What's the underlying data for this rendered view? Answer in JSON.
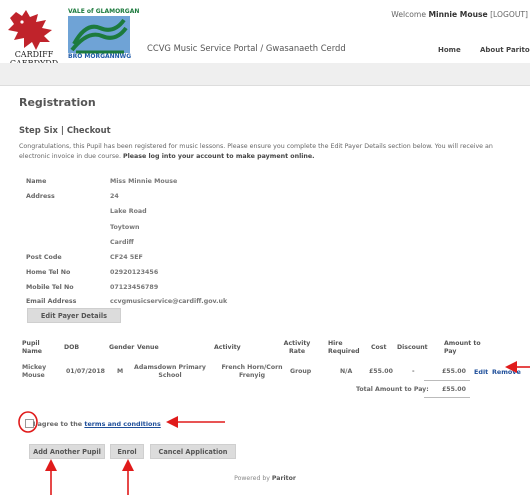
{
  "header": {
    "cardiff_logo_line1": "CARDIFF",
    "cardiff_logo_line2": "CAERDYDD",
    "vog_logo_top": "VALE of GLAMORGAN",
    "vog_logo_bottom": "BRO MORGANNWG",
    "portal_title": "CCVG Music Service Portal / Gwasanaeth Cerdd",
    "welcome_prefix": "Welcome",
    "user_name": "Minnie Mouse",
    "logout_label": "[LOGOUT]",
    "nav": {
      "home": "Home",
      "about": "About Paritor"
    }
  },
  "page": {
    "title": "Registration",
    "step": "Step Six | Checkout",
    "message": "Congratulations, this Pupil has been registered for music lessons. Please ensure you complete the Edit Payer Details section below. You will receive an electronic invoice in due course.",
    "message_bold": "Please log into your account to make payment online."
  },
  "payer": {
    "name_label": "Name",
    "name": "Miss Minnie Mouse",
    "address_label": "Address",
    "address_lines": [
      "24",
      "Lake Road",
      "Toytown",
      "Cardiff"
    ],
    "postcode_label": "Post Code",
    "postcode": "CF24 5EF",
    "home_tel_label": "Home Tel No",
    "home_tel": "02920123456",
    "mobile_tel_label": "Mobile Tel No",
    "mobile_tel": "07123456789",
    "email_label": "Email Address",
    "email": "ccvgmusicservice@cardiff.gov.uk",
    "edit_button": "Edit Payer Details"
  },
  "table": {
    "headers": {
      "pupil_name": [
        "Pupil",
        "Name"
      ],
      "dob": "DOB",
      "gender": "Gender",
      "venue": "Venue",
      "activity": "Activity",
      "activity_rate": [
        "Activity",
        "Rate"
      ],
      "hire_required": [
        "Hire",
        "Required"
      ],
      "cost": "Cost",
      "discount": "Discount",
      "amount": [
        "Amount to",
        "Pay"
      ]
    },
    "row": {
      "pupil_name": [
        "Mickey",
        "Mouse"
      ],
      "dob": "01/07/2018",
      "gender": "M",
      "venue": [
        "Adamsdown Primary",
        "School"
      ],
      "activity": [
        "French Horn/Corn",
        "Frenyig"
      ],
      "activity_rate": "Group",
      "hire_required": "N/A",
      "cost": "£55.00",
      "discount": "-",
      "amount": "£55.00",
      "edit": "Edit",
      "remove": "Remove"
    },
    "total_label": "Total Amount to Pay:",
    "total_value": "£55.00"
  },
  "agree": {
    "prefix": "I agree to the",
    "link": "terms and conditions"
  },
  "actions": {
    "add_pupil": "Add Another Pupil",
    "enrol": "Enrol",
    "cancel": "Cancel Application"
  },
  "footer": {
    "powered_prefix": "Powered by",
    "powered_brand": "Paritor"
  },
  "colors": {
    "annotation_red": "#e01b1b",
    "link_blue": "#1f4f9a",
    "header_bar": "#efefef"
  }
}
